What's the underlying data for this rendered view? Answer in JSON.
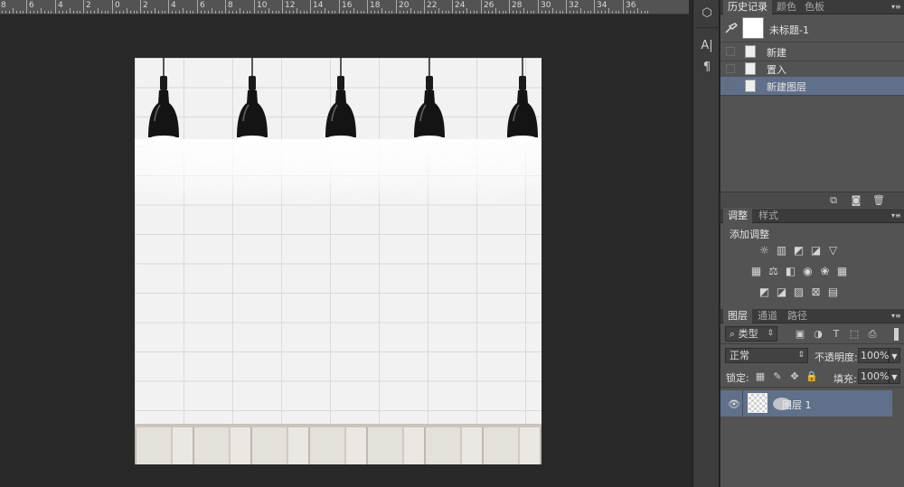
{
  "ruler": {
    "labels": [
      "8",
      "6",
      "4",
      "2",
      "0",
      "2",
      "4",
      "6",
      "8",
      "10",
      "12",
      "14",
      "16",
      "18",
      "20",
      "22",
      "24",
      "26",
      "28",
      "30",
      "32",
      "34",
      "36"
    ]
  },
  "document": {
    "lamp_count": 5
  },
  "toolstrip": {
    "icons": [
      "3d-cube-icon",
      "character-icon",
      "paragraph-icon"
    ],
    "glyphs": [
      "⬡",
      "A|",
      "¶"
    ]
  },
  "history_panel": {
    "tabs": [
      "历史记录",
      "颜色",
      "色板"
    ],
    "snapshot_label": "未标题-1",
    "items": [
      {
        "label": "新建",
        "selected": false
      },
      {
        "label": "置入",
        "selected": false
      },
      {
        "label": "新建图层",
        "selected": true
      }
    ]
  },
  "adjustments_panel": {
    "tabs": [
      "调整",
      "样式"
    ],
    "heading": "添加调整",
    "row1": [
      "brightness-icon",
      "levels-icon",
      "curves-icon",
      "exposure-icon",
      "vibrance-icon"
    ],
    "row2": [
      "hue-saturation-icon",
      "color-balance-icon",
      "black-white-icon",
      "photo-filter-icon",
      "channel-mixer-icon",
      "color-lookup-icon"
    ],
    "row3": [
      "invert-icon",
      "posterize-icon",
      "threshold-icon",
      "selective-color-icon",
      "gradient-map-icon"
    ]
  },
  "layers_panel": {
    "tabs": [
      "图层",
      "通道",
      "路径"
    ],
    "filter_label": "类型",
    "blend_mode": "正常",
    "opacity_label": "不透明度:",
    "opacity_value": "100%",
    "lock_label": "锁定:",
    "fill_label": "填充:",
    "fill_value": "100%",
    "layer_name": "图层 1"
  },
  "colors": {
    "selection": "#60708a",
    "panel_bg": "#535353",
    "workspace": "#282828"
  }
}
